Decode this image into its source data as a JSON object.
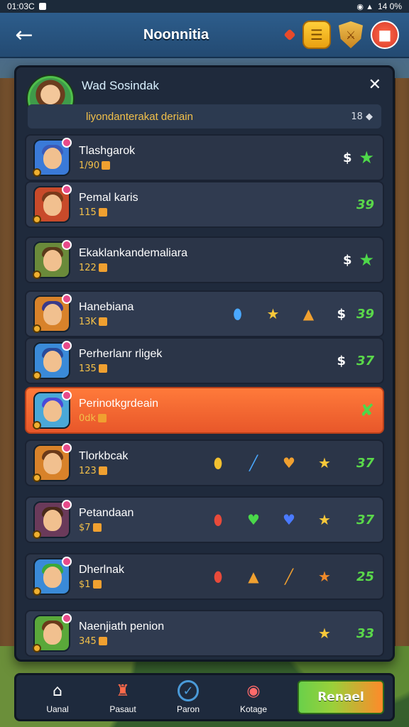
{
  "status_bar": {
    "time": "01:03C",
    "battery": "14 0%"
  },
  "header": {
    "title": "Noonnitia"
  },
  "panel": {
    "player_name": "Wad Sosindak",
    "subtitle": "liyondanterakat deriain",
    "count": "18"
  },
  "rows": [
    {
      "name": "Tlashgarok",
      "sub": "1/90",
      "cost": "$",
      "score": "",
      "end": "green-star",
      "items": []
    },
    {
      "name": "Pemal karis",
      "sub": "115",
      "cost": "",
      "score": "39",
      "end": "",
      "items": []
    },
    {
      "name": "Ekaklankandemaliara",
      "sub": "122",
      "cost": "$",
      "score": "",
      "end": "green-star",
      "items": []
    },
    {
      "name": "Hanebiana",
      "sub": "13K",
      "cost": "$",
      "score": "39",
      "end": "",
      "items": [
        "blue-gem-icon",
        "gold-star-icon",
        "orange-shard-icon"
      ]
    },
    {
      "name": "Perherlanr rligek",
      "sub": "135",
      "cost": "$",
      "score": "37",
      "end": "",
      "items": []
    },
    {
      "name": "Perinotkgrdeain",
      "sub": "0dk",
      "cost": "",
      "score": "",
      "end": "green-check",
      "items": []
    },
    {
      "name": "Tlorkbcak",
      "sub": "123",
      "cost": "",
      "score": "37",
      "end": "",
      "items": [
        "gold-gem-icon",
        "blue-wand-icon",
        "orange-heart-icon",
        "gold-star-icon"
      ]
    },
    {
      "name": "Petandaan",
      "sub": "$7",
      "cost": "",
      "score": "37",
      "end": "",
      "items": [
        "red-gem-icon",
        "green-heart-icon",
        "blue-heart-icon",
        "gold-star-icon"
      ]
    },
    {
      "name": "Dherlnak",
      "sub": "$1",
      "cost": "",
      "score": "25",
      "end": "",
      "items": [
        "red-gem-icon",
        "orange-shard-icon",
        "orange-wand-icon",
        "orange-star-icon"
      ]
    },
    {
      "name": "Naenjiath penion",
      "sub": "345",
      "cost": "",
      "score": "33",
      "end": "",
      "items": [
        "gold-star-icon"
      ]
    }
  ],
  "nav": {
    "items": [
      {
        "label": "Uanal"
      },
      {
        "label": "Pasaut"
      },
      {
        "label": "Paron"
      },
      {
        "label": "Kotage"
      }
    ],
    "primary_label": "Renael"
  },
  "colors": {
    "accent": "#e8572a",
    "score": "#5ad84a",
    "gold": "#f2c04a",
    "panel": "#1f2a3c"
  }
}
